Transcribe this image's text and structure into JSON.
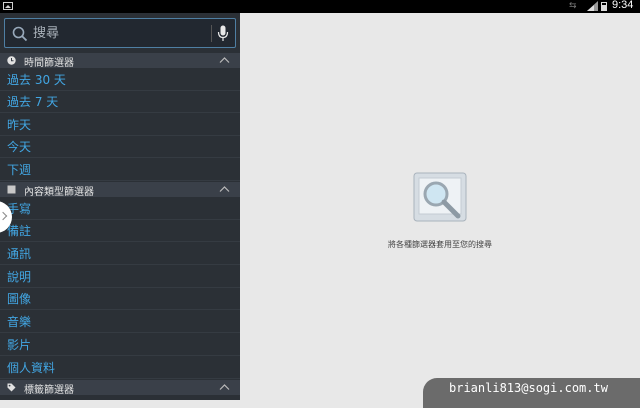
{
  "status_bar": {
    "time": "9:34"
  },
  "sidebar": {
    "search": {
      "placeholder": "搜尋"
    },
    "time_filter": {
      "header": "時間篩選器",
      "items": [
        "過去 30 天",
        "過去 7 天",
        "昨天",
        "今天",
        "下週"
      ]
    },
    "content_filter": {
      "header": "內容類型篩選器",
      "items": [
        "手寫",
        "備註",
        "通訊",
        "說明",
        "圖像",
        "音樂",
        "影片",
        "個人資料"
      ]
    },
    "tag_filter": {
      "header": "標籤篩選器"
    }
  },
  "main": {
    "empty_message": "將各種篩選器套用至您的搜尋"
  },
  "watermark": "brianli813@sogi.com.tw",
  "colors": {
    "accent": "#42a6e3",
    "sidebar_bg": "#2b3036",
    "header_bg": "#3a4049",
    "main_bg": "#e8e8e8"
  }
}
